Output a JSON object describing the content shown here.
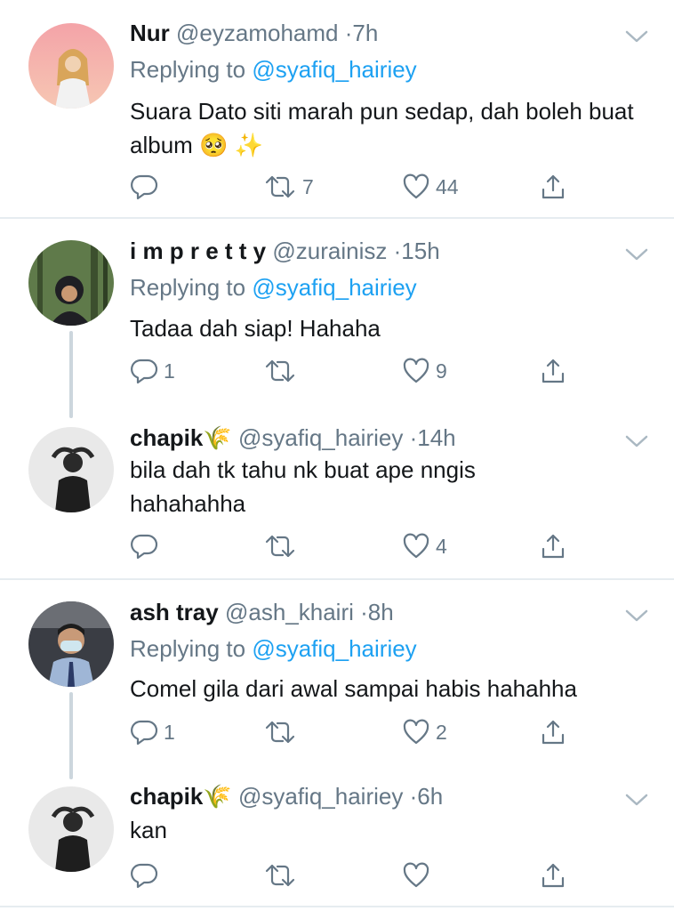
{
  "tweets": [
    {
      "name": "Nur",
      "handle": "@eyzamohamd",
      "time": "7h",
      "replying_label": "Replying to",
      "replying_user": "@syafiq_hairiey",
      "text": "Suara Dato siti marah pun sedap, dah boleh buat album 🥺 ✨",
      "reply_count": "",
      "retweet_count": "7",
      "like_count": "44"
    },
    {
      "name": "i m p r e t t y",
      "handle": "@zurainisz",
      "time": "15h",
      "replying_label": "Replying to",
      "replying_user": "@syafiq_hairiey",
      "text": "Tadaa dah siap! Hahaha",
      "reply_count": "1",
      "retweet_count": "",
      "like_count": "9"
    },
    {
      "name": "chapik🌾",
      "handle": "@syafiq_hairiey",
      "time": "14h",
      "text": "bila dah tk tahu nk buat ape nngis hahahahha",
      "reply_count": "",
      "retweet_count": "",
      "like_count": "4"
    },
    {
      "name": "ash tray",
      "handle": "@ash_khairi",
      "time": "8h",
      "replying_label": "Replying to",
      "replying_user": "@syafiq_hairiey",
      "text": "Comel gila dari awal sampai habis hahahha",
      "reply_count": "1",
      "retweet_count": "",
      "like_count": "2"
    },
    {
      "name": "chapik🌾",
      "handle": "@syafiq_hairiey",
      "time": "6h",
      "text": "kan",
      "reply_count": "",
      "retweet_count": "",
      "like_count": ""
    }
  ],
  "separator": "·",
  "colors": {
    "link": "#1da1f2",
    "muted": "#657786",
    "text": "#14171a",
    "divider": "#e6ecf0"
  },
  "icons": [
    "reply-icon",
    "retweet-icon",
    "like-icon",
    "share-icon",
    "chevron-down-icon"
  ]
}
